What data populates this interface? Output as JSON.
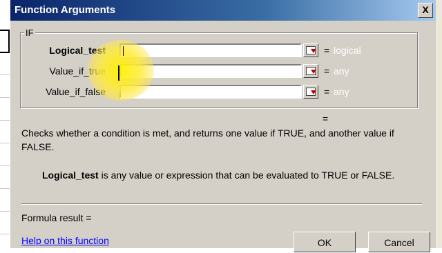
{
  "window": {
    "title": "Function Arguments",
    "close_glyph": "X"
  },
  "group": {
    "label": "IF"
  },
  "arguments": [
    {
      "label": "Logical_test",
      "value": "",
      "result": "logical"
    },
    {
      "label": "Value_if_true",
      "value": "",
      "result": "any"
    },
    {
      "label": "Value_if_false",
      "value": "",
      "result": "any"
    }
  ],
  "equals": "=",
  "function_result_equals": "=",
  "description": "Checks whether a condition is met, and returns one value if TRUE, and another value if FALSE.",
  "argument_help": {
    "name": "Logical_test",
    "text": " is any value or expression that can be evaluated to TRUE or FALSE."
  },
  "formula_result": "Formula result =",
  "help_link": "Help on this function",
  "buttons": {
    "ok": "OK",
    "cancel": "Cancel"
  },
  "colors": {
    "title_start": "#0a246a",
    "title_end": "#a6caf0",
    "dialog_bg": "#d4d0c8",
    "highlight": "#fff000"
  }
}
